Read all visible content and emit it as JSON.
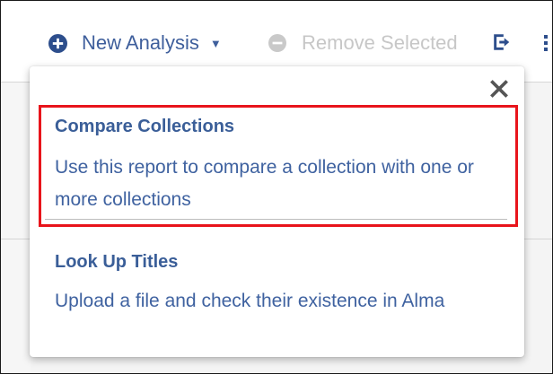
{
  "toolbar": {
    "new_analysis_label": "New Analysis",
    "remove_selected_label": "Remove Selected"
  },
  "dropdown": {
    "items": [
      {
        "title": "Compare Collections",
        "description": "Use this report to compare a collection with one or more collections"
      },
      {
        "title": "Look Up Titles",
        "description": "Upload a file and check their existence in Alma"
      }
    ]
  },
  "icons": {
    "new_analysis": "plus-circle-icon",
    "caret": "caret-down-icon",
    "remove_selected": "minus-circle-icon",
    "export": "export-icon",
    "more": "more-vertical-icon",
    "close": "close-icon"
  },
  "colors": {
    "accent": "#3f5f9c",
    "disabled": "#c7c7c7",
    "highlight": "#e8141b"
  }
}
